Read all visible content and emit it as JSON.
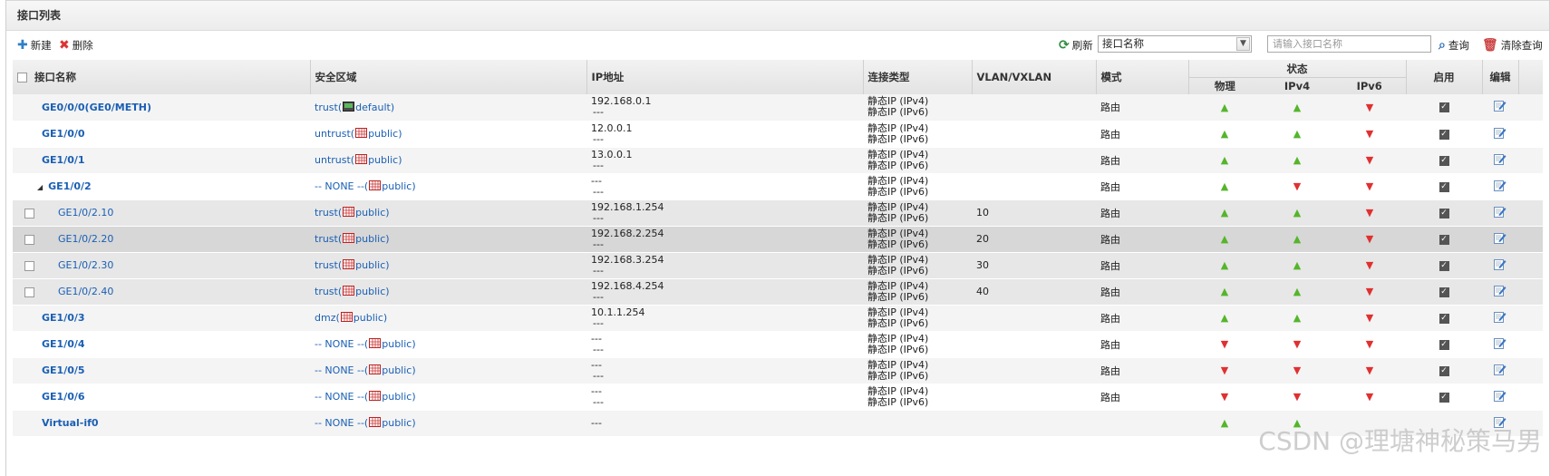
{
  "panel_title": "接口列表",
  "toolbar": {
    "new_label": "新建",
    "delete_label": "删除",
    "refresh_label": "刷新",
    "filter_selected": "接口名称",
    "search_placeholder": "请输入接口名称",
    "query_label": "查询",
    "clear_query_label": "清除查询"
  },
  "columns": {
    "name": "接口名称",
    "zone": "安全区域",
    "ip": "IP地址",
    "conn_type": "连接类型",
    "vlan": "VLAN/VXLAN",
    "mode": "模式",
    "status": "状态",
    "physical": "物理",
    "ipv4": "IPv4",
    "ipv6": "IPv6",
    "enable": "启用",
    "edit": "编辑"
  },
  "rows": [
    {
      "name": "GE0/0/0(GE0/METH)",
      "zone": "trust(",
      "vsys": "default)",
      "ip1": "192.168.0.1",
      "ip2": "---",
      "c1": "静态IP (IPv4)",
      "c2": "静态IP (IPv6)",
      "vlan": "",
      "mode": "路由",
      "phy": "up",
      "v4": "up",
      "v6": "down",
      "enabled": true
    },
    {
      "name": "GE1/0/0",
      "zone": "untrust(",
      "vsys": "public)",
      "ip1": "12.0.0.1",
      "ip2": "---",
      "c1": "静态IP (IPv4)",
      "c2": "静态IP (IPv6)",
      "vlan": "",
      "mode": "路由",
      "phy": "up",
      "v4": "up",
      "v6": "down",
      "enabled": true
    },
    {
      "name": "GE1/0/1",
      "zone": "untrust(",
      "vsys": "public)",
      "ip1": "13.0.0.1",
      "ip2": "---",
      "c1": "静态IP (IPv4)",
      "c2": "静态IP (IPv6)",
      "vlan": "",
      "mode": "路由",
      "phy": "up",
      "v4": "up",
      "v6": "down",
      "enabled": true
    },
    {
      "name": "GE1/0/2",
      "zone": "-- NONE --(",
      "vsys": "public)",
      "ip1": "---",
      "ip2": "---",
      "c1": "静态IP (IPv4)",
      "c2": "静态IP (IPv6)",
      "vlan": "",
      "mode": "路由",
      "phy": "up",
      "v4": "down",
      "v6": "down",
      "enabled": true
    },
    {
      "name": "GE1/0/2.10",
      "zone": "trust(",
      "vsys": "public)",
      "ip1": "192.168.1.254",
      "ip2": "---",
      "c1": "静态IP (IPv4)",
      "c2": "静态IP (IPv6)",
      "vlan": "10",
      "mode": "路由",
      "phy": "up",
      "v4": "up",
      "v6": "down",
      "enabled": true
    },
    {
      "name": "GE1/0/2.20",
      "zone": "trust(",
      "vsys": "public)",
      "ip1": "192.168.2.254",
      "ip2": "---",
      "c1": "静态IP (IPv4)",
      "c2": "静态IP (IPv6)",
      "vlan": "20",
      "mode": "路由",
      "phy": "up",
      "v4": "up",
      "v6": "down",
      "enabled": true
    },
    {
      "name": "GE1/0/2.30",
      "zone": "trust(",
      "vsys": "public)",
      "ip1": "192.168.3.254",
      "ip2": "---",
      "c1": "静态IP (IPv4)",
      "c2": "静态IP (IPv6)",
      "vlan": "30",
      "mode": "路由",
      "phy": "up",
      "v4": "up",
      "v6": "down",
      "enabled": true
    },
    {
      "name": "GE1/0/2.40",
      "zone": "trust(",
      "vsys": "public)",
      "ip1": "192.168.4.254",
      "ip2": "---",
      "c1": "静态IP (IPv4)",
      "c2": "静态IP (IPv6)",
      "vlan": "40",
      "mode": "路由",
      "phy": "up",
      "v4": "up",
      "v6": "down",
      "enabled": true
    },
    {
      "name": "GE1/0/3",
      "zone": "dmz(",
      "vsys": "public)",
      "ip1": "10.1.1.254",
      "ip2": "---",
      "c1": "静态IP (IPv4)",
      "c2": "静态IP (IPv6)",
      "vlan": "",
      "mode": "路由",
      "phy": "up",
      "v4": "up",
      "v6": "down",
      "enabled": true
    },
    {
      "name": "GE1/0/4",
      "zone": "-- NONE --(",
      "vsys": "public)",
      "ip1": "---",
      "ip2": "---",
      "c1": "静态IP (IPv4)",
      "c2": "静态IP (IPv6)",
      "vlan": "",
      "mode": "路由",
      "phy": "down",
      "v4": "down",
      "v6": "down",
      "enabled": true
    },
    {
      "name": "GE1/0/5",
      "zone": "-- NONE --(",
      "vsys": "public)",
      "ip1": "---",
      "ip2": "---",
      "c1": "静态IP (IPv4)",
      "c2": "静态IP (IPv6)",
      "vlan": "",
      "mode": "路由",
      "phy": "down",
      "v4": "down",
      "v6": "down",
      "enabled": true
    },
    {
      "name": "GE1/0/6",
      "zone": "-- NONE --(",
      "vsys": "public)",
      "ip1": "---",
      "ip2": "---",
      "c1": "静态IP (IPv4)",
      "c2": "静态IP (IPv6)",
      "vlan": "",
      "mode": "路由",
      "phy": "down",
      "v4": "down",
      "v6": "down",
      "enabled": true
    },
    {
      "name": "Virtual-if0",
      "zone": "-- NONE --(",
      "vsys": "public)",
      "ip1": "---",
      "ip2": "",
      "c1": "",
      "c2": "",
      "vlan": "",
      "mode": "",
      "phy": "up",
      "v4": "up",
      "v6": "",
      "enabled": false
    }
  ],
  "watermark": "CSDN @理塘神秘策马男",
  "colors": {
    "link": "#1a5fb4",
    "up": "#55b52b",
    "down": "#e03030"
  }
}
